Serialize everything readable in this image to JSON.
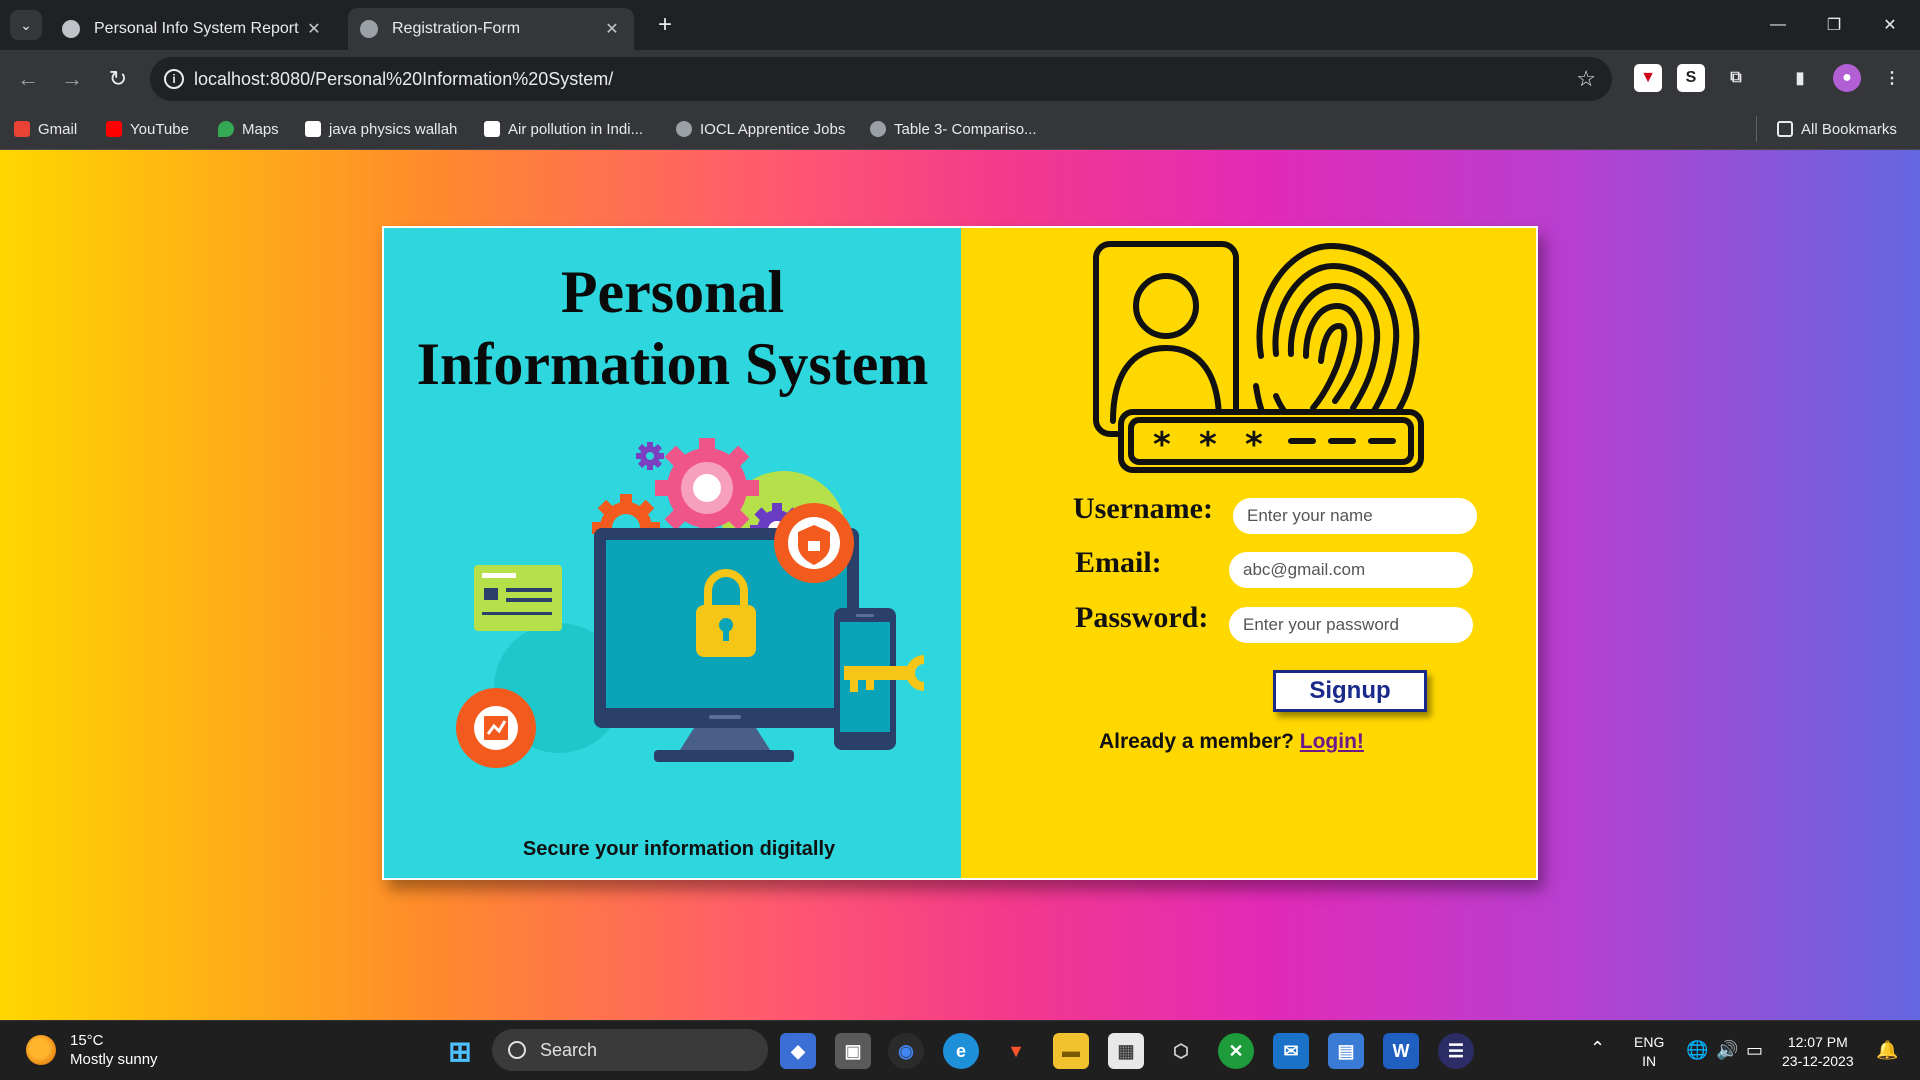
{
  "browser": {
    "tabs": [
      {
        "title": "Personal Info System Report",
        "active": false
      },
      {
        "title": "Registration-Form",
        "active": true
      }
    ],
    "url": "localhost:8080/Personal%20Information%20System/",
    "bookmarks": [
      {
        "label": "Gmail",
        "color": "#ea4335"
      },
      {
        "label": "YouTube",
        "color": "#ff0000"
      },
      {
        "label": "Maps",
        "color": "#34a853"
      },
      {
        "label": "java physics wallah",
        "color": "#ffffff"
      },
      {
        "label": "Air pollution in Indi...",
        "color": "#ffffff"
      },
      {
        "label": "IOCL Apprentice Jobs",
        "color": "#9aa0a6"
      },
      {
        "label": "Table 3-  Compariso...",
        "color": "#9aa0a6"
      }
    ],
    "all_bookmarks": "All Bookmarks"
  },
  "page": {
    "title_line1": "Personal",
    "title_line2": "Information System",
    "tagline": "Secure your information digitally",
    "form": {
      "username_label": "Username:",
      "username_placeholder": "Enter your name",
      "email_label": "Email:",
      "email_placeholder": "abc@gmail.com",
      "password_label": "Password:",
      "password_placeholder": "Enter your password",
      "signup_label": "Signup",
      "member_text": "Already a member?",
      "login_link": "Login!"
    },
    "colors": {
      "left_panel": "#2ed6dd",
      "right_panel": "#ffd800",
      "button_text": "#1a2a8a"
    }
  },
  "taskbar": {
    "weather_temp": "15°C",
    "weather_desc": "Mostly sunny",
    "search_label": "Search",
    "lang_line1": "ENG",
    "lang_line2": "IN",
    "time": "12:07 PM",
    "date": "23-12-2023"
  }
}
